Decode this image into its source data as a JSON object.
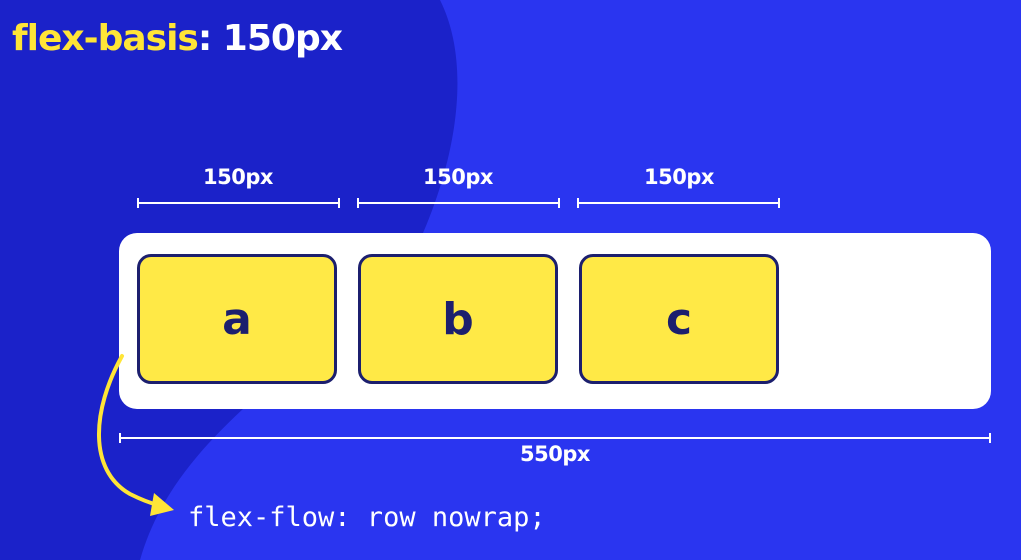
{
  "title": {
    "property": "flex-basis",
    "separator": ":",
    "value": "150px"
  },
  "item_dimensions": [
    "150px",
    "150px",
    "150px"
  ],
  "container_dimension": "550px",
  "items": [
    "a",
    "b",
    "c"
  ],
  "code": "flex-flow: row nowrap;",
  "colors": {
    "background": "#2a35f0",
    "accent_yellow": "#ffe537",
    "item_fill": "#ffe946",
    "item_border": "#1c1f6e",
    "container": "#ffffff"
  }
}
